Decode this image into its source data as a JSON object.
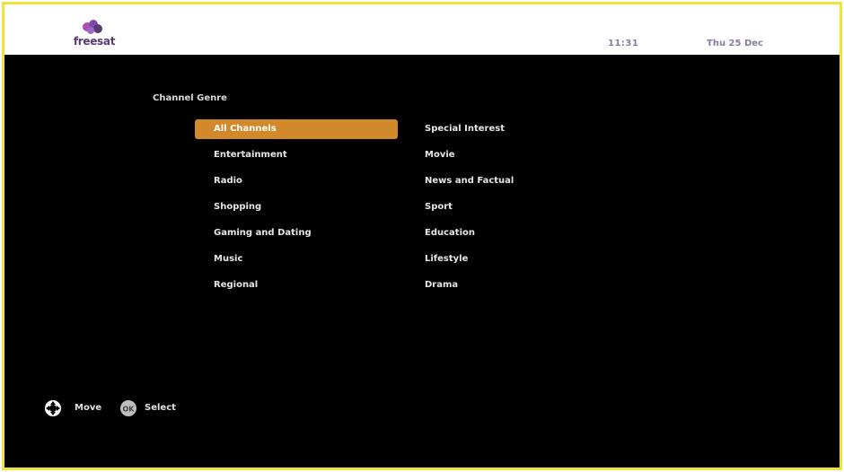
{
  "header": {
    "brand": "freesat",
    "time": "11:31",
    "date": "Thu 25 Dec"
  },
  "menu": {
    "title": "Channel Genre",
    "left_column": [
      {
        "label": "All Channels",
        "selected": true
      },
      {
        "label": "Entertainment",
        "selected": false
      },
      {
        "label": "Radio",
        "selected": false
      },
      {
        "label": "Shopping",
        "selected": false
      },
      {
        "label": "Gaming and Dating",
        "selected": false
      },
      {
        "label": "Music",
        "selected": false
      },
      {
        "label": "Regional",
        "selected": false
      }
    ],
    "right_column": [
      {
        "label": "Special Interest",
        "selected": false
      },
      {
        "label": "Movie",
        "selected": false
      },
      {
        "label": "News and Factual",
        "selected": false
      },
      {
        "label": "Sport",
        "selected": false
      },
      {
        "label": "Education",
        "selected": false
      },
      {
        "label": "Lifestyle",
        "selected": false
      },
      {
        "label": "Drama",
        "selected": false
      }
    ]
  },
  "footer": {
    "move_label": "Move",
    "move_icon": "dpad-icon",
    "select_label": "Select",
    "select_icon": "ok-button-icon",
    "ok_text": "OK"
  },
  "colors": {
    "frame_border": "#f0e33c",
    "selection": "#d1892c",
    "background": "#000000",
    "brand": "#5a3a76"
  }
}
